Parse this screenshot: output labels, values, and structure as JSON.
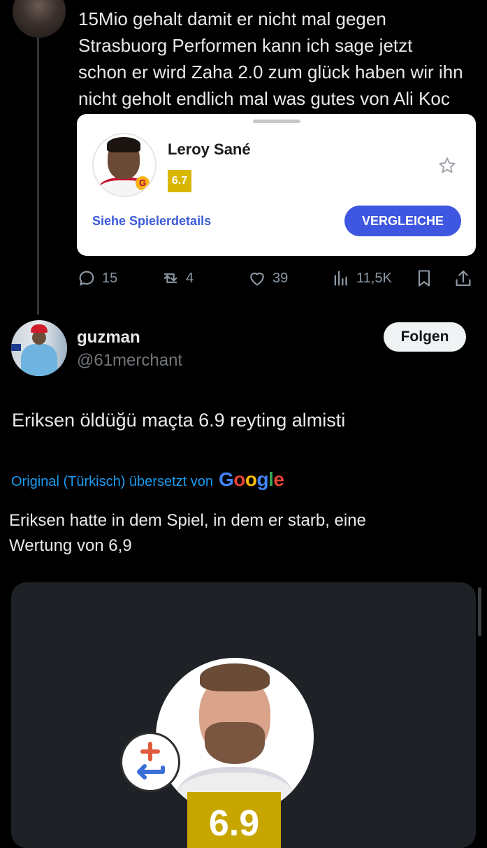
{
  "tweet1": {
    "lines": [
      "15Mio gehalt damit er nicht mal gegen",
      "Strasbuorg Performen kann ich sage jetzt",
      "schon er wird Zaha 2.0 zum glück haben wir ihn",
      "nicht geholt endlich mal was gutes von Ali Koc"
    ]
  },
  "player_card": {
    "name": "Leroy Sané",
    "rating": "6.7",
    "rating_color": "#d9b600",
    "details_link": "Siehe Spielerdetails",
    "compare_button": "VERGLEICHE",
    "accent_color": "#3e56e0",
    "club_badge": "G",
    "icons": [
      "player-photo",
      "favorite-star-icon"
    ]
  },
  "actions": {
    "replies": "15",
    "reposts": "4",
    "likes": "39",
    "views": "11,5K",
    "icons": [
      "reply-icon",
      "repost-icon",
      "like-icon",
      "views-icon",
      "bookmark-icon",
      "share-icon"
    ]
  },
  "tweet2": {
    "display_name": "guzman",
    "handle": "@61merchant",
    "follow_label": "Folgen",
    "text": "Eriksen öldüğü maçta 6.9 reyting almisti",
    "translation_label": "Original (Türkisch) übersetzt von",
    "translation_provider": "Google",
    "translated_lines": [
      "Eriksen hatte in dem Spiel, in dem er starb, eine",
      "Wertung von 6,9"
    ],
    "media_rating": "6.9",
    "media_rating_color": "#c8a600"
  },
  "colors": {
    "background": "#000000",
    "link_blue": "#1d9bf0",
    "muted_text": "#71767b"
  }
}
